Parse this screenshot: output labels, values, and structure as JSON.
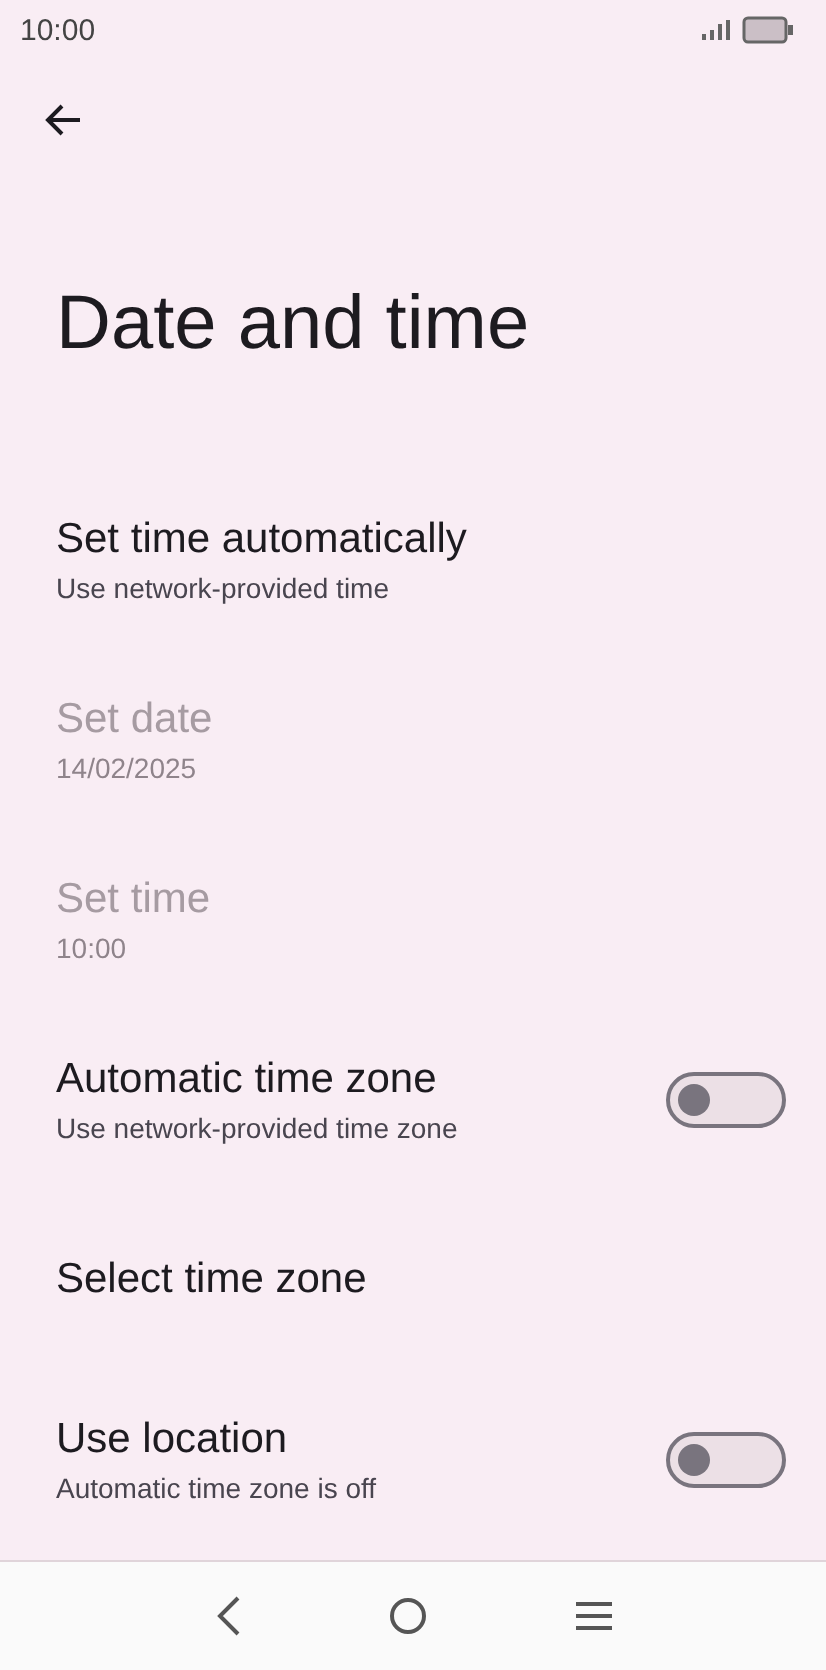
{
  "status_bar": {
    "time": "10:00"
  },
  "title": "Date and time",
  "items": [
    {
      "kind": "text",
      "title": "Set time automatically",
      "subtitle": "Use network-provided time",
      "disabled": false
    },
    {
      "kind": "text",
      "title": "Set date",
      "subtitle": "14/02/2025",
      "disabled": true
    },
    {
      "kind": "text",
      "title": "Set time",
      "subtitle": "10:00",
      "disabled": true
    },
    {
      "kind": "switch",
      "title": "Automatic time zone",
      "subtitle": "Use network-provided time zone",
      "disabled": false,
      "on": false
    },
    {
      "kind": "text",
      "title": "Select time zone",
      "disabled": false
    },
    {
      "kind": "switch",
      "title": "Use location",
      "subtitle": "Automatic time zone is off",
      "disabled": false,
      "on": false
    }
  ]
}
